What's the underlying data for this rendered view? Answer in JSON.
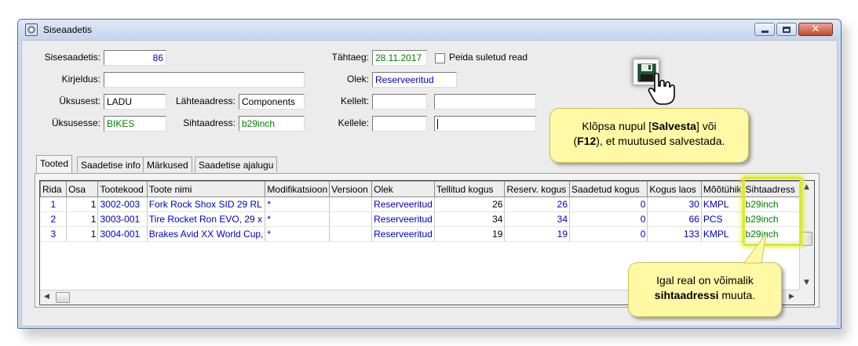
{
  "window": {
    "title": "Siseaadetis",
    "close_glyph": "✕"
  },
  "form": {
    "sisesaadetis": {
      "label": "Sisesaadetis:",
      "value": "86"
    },
    "kirjeldus": {
      "label": "Kirjeldus:",
      "value": ""
    },
    "uksusest": {
      "label": "Üksusest:",
      "value": "LADU"
    },
    "lahteaadress": {
      "label": "Lähteaadress:",
      "value": "Components"
    },
    "uksusesse": {
      "label": "Üksusesse:",
      "value": "BIKES"
    },
    "sihtaadress": {
      "label": "Sihtaadress:",
      "value": "b29inch"
    },
    "tahtaeg": {
      "label": "Tähtaeg:",
      "value": "28.11.2017"
    },
    "peida": {
      "label": "Peida suletud read",
      "checked": false
    },
    "olek": {
      "label": "Olek:",
      "value": "Reserveeritud"
    },
    "kellelt": {
      "label": "Kellelt:",
      "value1": "",
      "value2": ""
    },
    "kellele": {
      "label": "Kellele:",
      "value1": "",
      "value2": ""
    }
  },
  "tabs": [
    {
      "label": "Tooted"
    },
    {
      "label": "Saadetise info"
    },
    {
      "label": "Märkused"
    },
    {
      "label": "Saadetise ajalugu"
    }
  ],
  "grid": {
    "columns": [
      "Rida",
      "Osa",
      "Tootekood",
      "Toote nimi",
      "Modifikatsioon",
      "Versioon",
      "Olek",
      "Tellitud kogus",
      "Reserv. kogus",
      "Saadetud kogus",
      "Kogus laos",
      "Mõõtühik",
      "Sihtaadress"
    ],
    "rows": [
      {
        "rida": "1",
        "osa": "1",
        "tootekood": "3002-003",
        "nimi": "Fork Rock Shox SID 29 RL",
        "mod": "*",
        "versioon": "",
        "olek": "Reserveeritud",
        "tellitud": "26",
        "reserv": "26",
        "saadetud": "0",
        "laos": "30",
        "uhik": "KMPL",
        "siht": "b29inch"
      },
      {
        "rida": "2",
        "osa": "1",
        "tootekood": "3003-001",
        "nimi": "Tire Rocket Ron EVO, 29 x",
        "mod": "*",
        "versioon": "",
        "olek": "Reserveeritud",
        "tellitud": "34",
        "reserv": "34",
        "saadetud": "0",
        "laos": "66",
        "uhik": "PCS",
        "siht": "b29inch"
      },
      {
        "rida": "3",
        "osa": "1",
        "tootekood": "3004-001",
        "nimi": "Brakes Avid XX World Cup,",
        "mod": "*",
        "versioon": "",
        "olek": "Reserveeritud",
        "tellitud": "19",
        "reserv": "19",
        "saadetud": "0",
        "laos": "133",
        "uhik": "KMPL",
        "siht": "b29inch"
      }
    ]
  },
  "callouts": {
    "save_line1_pre": "Klõpsa nupul [",
    "save_bold1": "Salvesta",
    "save_line1_post": "] või",
    "save_line2_pre": "(",
    "save_bold2": "F12",
    "save_line2_post": "), et muutused salvestada.",
    "address_line1": "Igal real on võimalik",
    "address_bold": "sihtaadressi",
    "address_line2_post": " muuta."
  },
  "colors": {
    "green_value": "#008000",
    "blue_value": "#0000c8",
    "callout_bg": "#fff9a6",
    "highlight": "#dcea23"
  }
}
